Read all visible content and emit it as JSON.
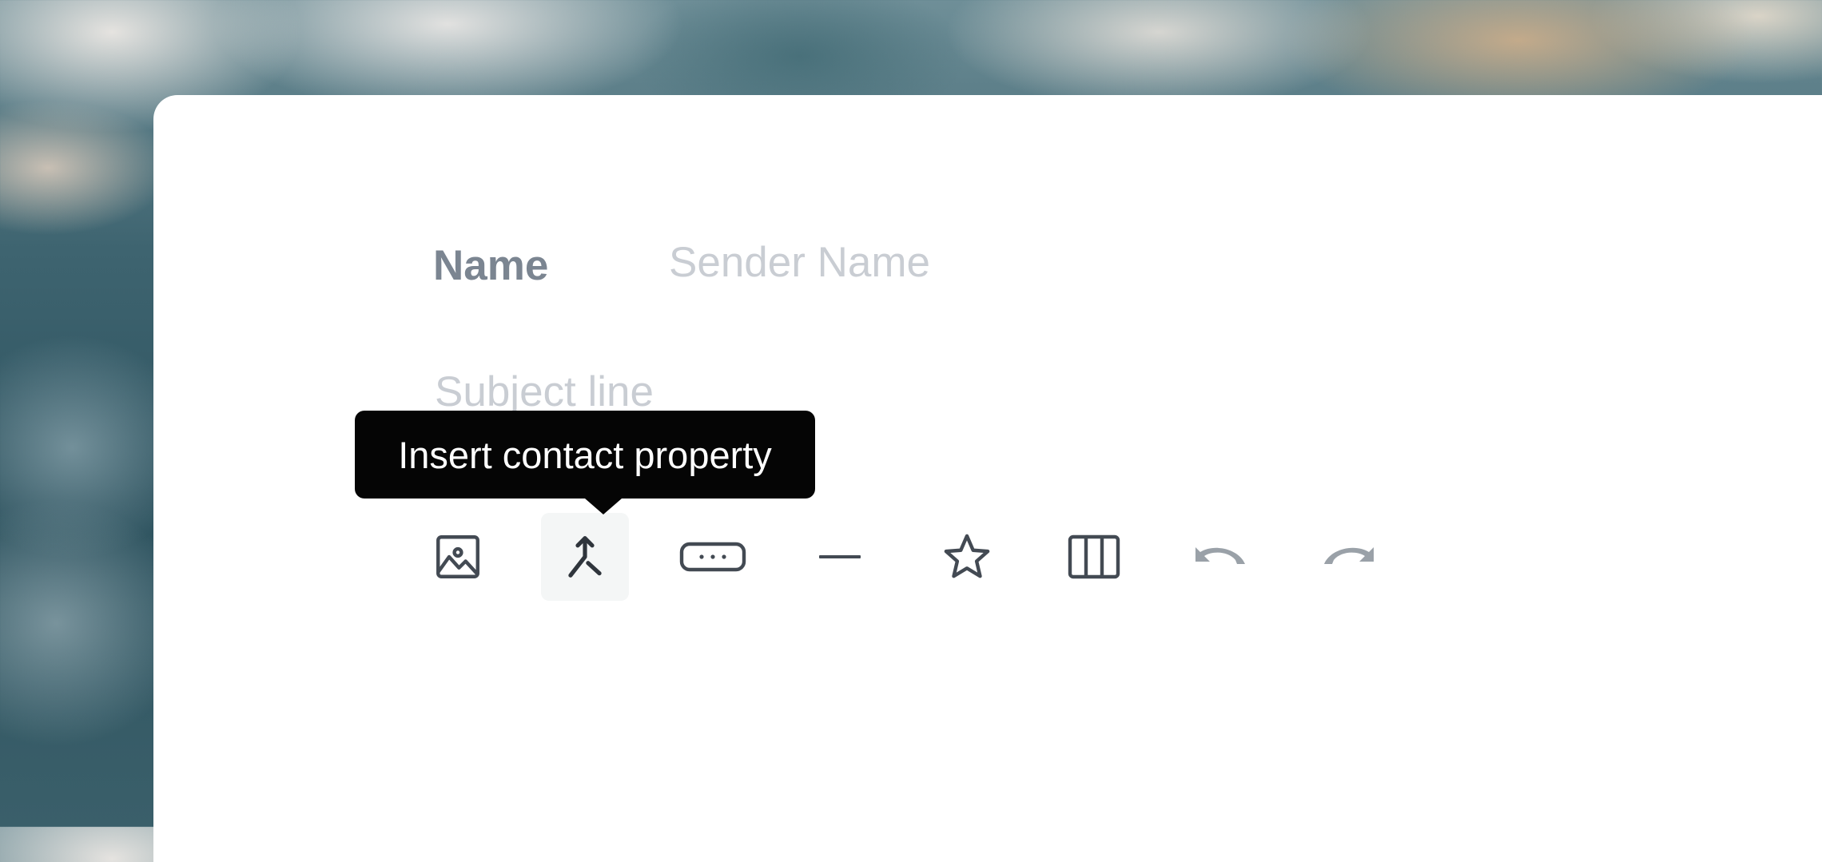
{
  "form": {
    "name_label": "Name",
    "sender_placeholder": "Sender Name",
    "subject_placeholder": "Subject line"
  },
  "toolbar": {
    "tooltip": "Insert contact property",
    "buttons": [
      {
        "icon": "image-icon",
        "label": "Insert image"
      },
      {
        "icon": "merge-icon",
        "label": "Insert contact property",
        "active": true
      },
      {
        "icon": "button-icon",
        "label": "Insert button"
      },
      {
        "icon": "divider-icon",
        "label": "Insert divider"
      },
      {
        "icon": "star-icon",
        "label": "Insert social"
      },
      {
        "icon": "columns-icon",
        "label": "Insert columns"
      },
      {
        "icon": "undo-icon",
        "label": "Undo"
      },
      {
        "icon": "redo-icon",
        "label": "Redo"
      }
    ]
  },
  "colors": {
    "icon": "#434a53",
    "icon_disabled": "#9aa1a8",
    "label": "#7b8591",
    "placeholder": "#c9cdd3",
    "tooltip_bg": "#050505"
  }
}
